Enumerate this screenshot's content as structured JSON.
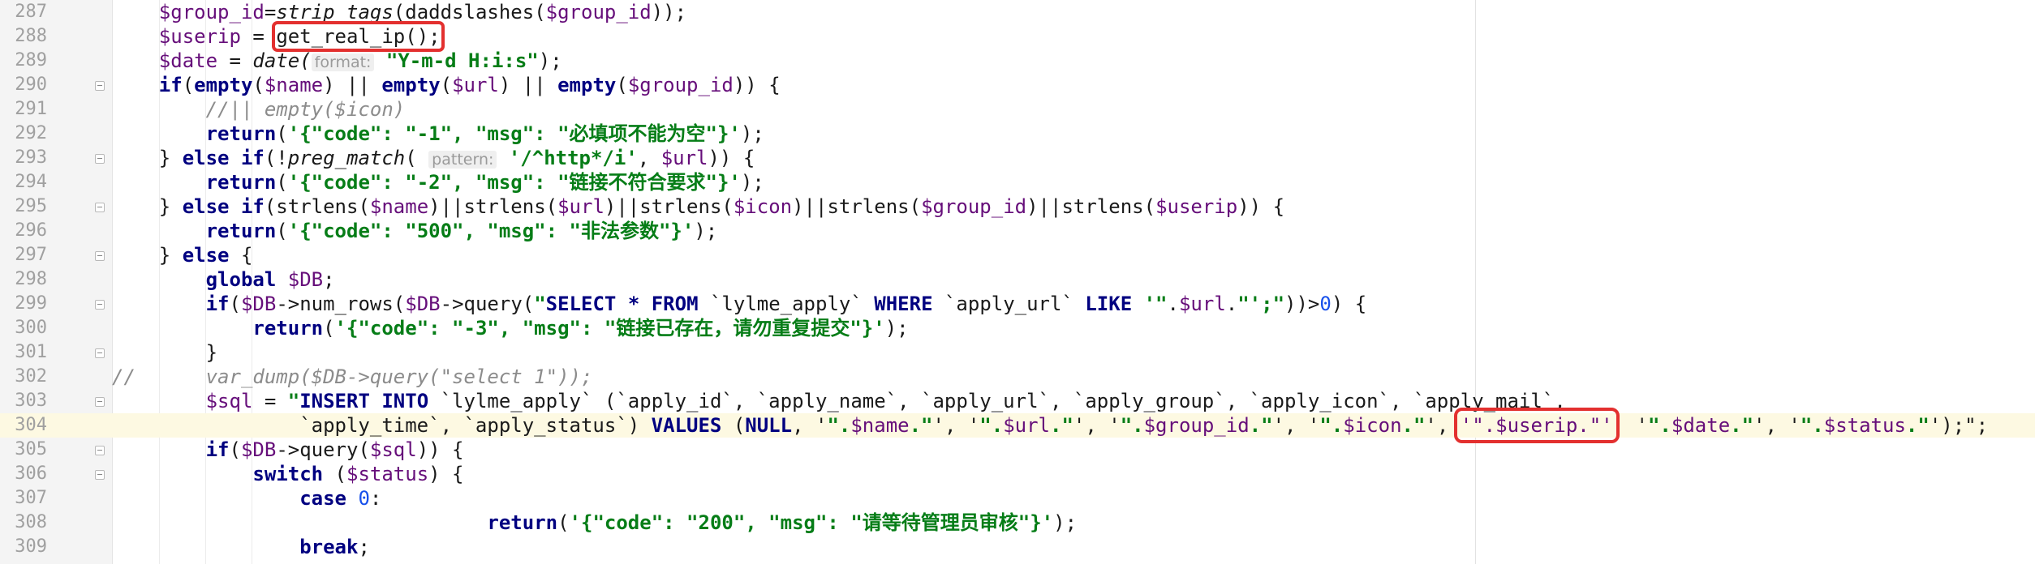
{
  "editor": {
    "lines": [
      {
        "num": "287",
        "indent": 1,
        "tokens": [
          {
            "t": "$group_id",
            "c": "var"
          },
          {
            "t": "=",
            "c": "fn"
          },
          {
            "t": "strip_tags",
            "c": "fni"
          },
          {
            "t": "(daddslashes(",
            "c": "fn"
          },
          {
            "t": "$group_id",
            "c": "var"
          },
          {
            "t": "));",
            "c": "fn"
          }
        ]
      },
      {
        "num": "288",
        "indent": 1,
        "tokens": [
          {
            "t": "$userip",
            "c": "var"
          },
          {
            "t": " = ",
            "c": "fn"
          },
          {
            "t": "get_real_ip();",
            "c": "fn",
            "box": "redbox"
          }
        ]
      },
      {
        "num": "289",
        "indent": 1,
        "tokens": [
          {
            "t": "$date",
            "c": "var"
          },
          {
            "t": " = ",
            "c": "fn"
          },
          {
            "t": "date(",
            "c": "fni"
          },
          {
            "t": "format:",
            "c": "hint"
          },
          {
            "t": " \"Y-m-d H:i:s\"",
            "c": "str"
          },
          {
            "t": ");",
            "c": "fn"
          }
        ]
      },
      {
        "num": "290",
        "indent": 1,
        "fold": true,
        "tokens": [
          {
            "t": "if",
            "c": "kw"
          },
          {
            "t": "(",
            "c": "fn"
          },
          {
            "t": "empty",
            "c": "kw"
          },
          {
            "t": "(",
            "c": "fn"
          },
          {
            "t": "$name",
            "c": "var"
          },
          {
            "t": ") || ",
            "c": "fn"
          },
          {
            "t": "empty",
            "c": "kw"
          },
          {
            "t": "(",
            "c": "fn"
          },
          {
            "t": "$url",
            "c": "var"
          },
          {
            "t": ") || ",
            "c": "fn"
          },
          {
            "t": "empty",
            "c": "kw"
          },
          {
            "t": "(",
            "c": "fn"
          },
          {
            "t": "$group_id",
            "c": "var"
          },
          {
            "t": ")) {",
            "c": "fn"
          }
        ]
      },
      {
        "num": "291",
        "indent": 2,
        "tokens": [
          {
            "t": "//|| empty($icon)",
            "c": "cmt"
          }
        ]
      },
      {
        "num": "292",
        "indent": 2,
        "tokens": [
          {
            "t": "return",
            "c": "kw"
          },
          {
            "t": "(",
            "c": "fn"
          },
          {
            "t": "'{\"code\": \"-1\", \"msg\": \"必填项不能为空\"}'",
            "c": "str"
          },
          {
            "t": ");",
            "c": "fn"
          }
        ]
      },
      {
        "num": "293",
        "indent": 1,
        "fold": true,
        "tokens": [
          {
            "t": "} ",
            "c": "fn"
          },
          {
            "t": "else if",
            "c": "kw"
          },
          {
            "t": "(!",
            "c": "fn"
          },
          {
            "t": "preg_match",
            "c": "fni"
          },
          {
            "t": "( ",
            "c": "fn"
          },
          {
            "t": "pattern:",
            "c": "hint"
          },
          {
            "t": " '/^http*/i'",
            "c": "str"
          },
          {
            "t": ", ",
            "c": "fn"
          },
          {
            "t": "$url",
            "c": "var"
          },
          {
            "t": ")) {",
            "c": "fn"
          }
        ]
      },
      {
        "num": "294",
        "indent": 2,
        "tokens": [
          {
            "t": "return",
            "c": "kw"
          },
          {
            "t": "(",
            "c": "fn"
          },
          {
            "t": "'{\"code\": \"-2\", \"msg\": \"链接不符合要求\"}'",
            "c": "str"
          },
          {
            "t": ");",
            "c": "fn"
          }
        ]
      },
      {
        "num": "295",
        "indent": 1,
        "fold": true,
        "tokens": [
          {
            "t": "} ",
            "c": "fn"
          },
          {
            "t": "else if",
            "c": "kw"
          },
          {
            "t": "(strlens(",
            "c": "fn"
          },
          {
            "t": "$name",
            "c": "var"
          },
          {
            "t": ")||strlens(",
            "c": "fn"
          },
          {
            "t": "$url",
            "c": "var"
          },
          {
            "t": ")||strlens(",
            "c": "fn"
          },
          {
            "t": "$icon",
            "c": "var"
          },
          {
            "t": ")||strlens(",
            "c": "fn"
          },
          {
            "t": "$group_id",
            "c": "var"
          },
          {
            "t": ")||strlens(",
            "c": "fn"
          },
          {
            "t": "$userip",
            "c": "var"
          },
          {
            "t": ")) {",
            "c": "fn"
          }
        ]
      },
      {
        "num": "296",
        "indent": 2,
        "tokens": [
          {
            "t": "return",
            "c": "kw"
          },
          {
            "t": "(",
            "c": "fn"
          },
          {
            "t": "'{\"code\": \"500\", \"msg\": \"非法参数\"}'",
            "c": "str"
          },
          {
            "t": ");",
            "c": "fn"
          }
        ]
      },
      {
        "num": "297",
        "indent": 1,
        "fold": true,
        "tokens": [
          {
            "t": "} ",
            "c": "fn"
          },
          {
            "t": "else",
            "c": "kw"
          },
          {
            "t": " {",
            "c": "fn"
          }
        ]
      },
      {
        "num": "298",
        "indent": 2,
        "tokens": [
          {
            "t": "global",
            "c": "kw"
          },
          {
            "t": " ",
            "c": "fn"
          },
          {
            "t": "$DB",
            "c": "var"
          },
          {
            "t": ";",
            "c": "fn"
          }
        ]
      },
      {
        "num": "299",
        "indent": 2,
        "fold": true,
        "tokens": [
          {
            "t": "if",
            "c": "kw"
          },
          {
            "t": "(",
            "c": "fn"
          },
          {
            "t": "$DB",
            "c": "var"
          },
          {
            "t": "->num_rows(",
            "c": "fn"
          },
          {
            "t": "$DB",
            "c": "var"
          },
          {
            "t": "->query(",
            "c": "fn"
          },
          {
            "t": "\"",
            "c": "str"
          },
          {
            "t": "SELECT * FROM",
            "c": "sqlkw"
          },
          {
            "t": " `lylme_apply` ",
            "c": "fn"
          },
          {
            "t": "WHERE",
            "c": "sqlkw"
          },
          {
            "t": " `apply_url` ",
            "c": "fn"
          },
          {
            "t": "LIKE",
            "c": "sqlkw"
          },
          {
            "t": " '\"",
            "c": "str"
          },
          {
            "t": ".",
            "c": "fn"
          },
          {
            "t": "$url",
            "c": "var"
          },
          {
            "t": ".",
            "c": "fn"
          },
          {
            "t": "\"';\"",
            "c": "str"
          },
          {
            "t": "))>",
            "c": "fn"
          },
          {
            "t": "0",
            "c": "num"
          },
          {
            "t": ") {",
            "c": "fn"
          }
        ]
      },
      {
        "num": "300",
        "indent": 3,
        "tokens": [
          {
            "t": "return",
            "c": "kw"
          },
          {
            "t": "(",
            "c": "fn"
          },
          {
            "t": "'{\"code\": \"-3\", \"msg\": \"链接已存在，请勿重复提交\"}'",
            "c": "str"
          },
          {
            "t": ");",
            "c": "fn"
          }
        ]
      },
      {
        "num": "301",
        "indent": 2,
        "fold": true,
        "tokens": [
          {
            "t": "}",
            "c": "fn"
          }
        ]
      },
      {
        "num": "302",
        "indent": 0,
        "tokens": [
          {
            "t": "//      var_dump($DB->query(\"select 1\"));",
            "c": "cmt"
          }
        ]
      },
      {
        "num": "303",
        "indent": 2,
        "fold": true,
        "tokens": [
          {
            "t": "$sql",
            "c": "var"
          },
          {
            "t": " = ",
            "c": "fn"
          },
          {
            "t": "\"",
            "c": "str"
          },
          {
            "t": "INSERT INTO",
            "c": "sqlkw"
          },
          {
            "t": " `lylme_apply` (`apply_id`, `apply_name`, `apply_url`, `apply_group`, `apply_icon`, `apply_mail`,",
            "c": "fn"
          }
        ]
      },
      {
        "num": "304",
        "indent": 4,
        "highlight": true,
        "tokens": [
          {
            "t": "`apply_time`, `apply_status`) ",
            "c": "fn"
          },
          {
            "t": "VALUES",
            "c": "sqlkw"
          },
          {
            "t": " (",
            "c": "fn"
          },
          {
            "t": "NULL",
            "c": "sqlkw"
          },
          {
            "t": ", '",
            "c": "fn"
          },
          {
            "t": "\".",
            "c": "str"
          },
          {
            "t": "$name",
            "c": "var"
          },
          {
            "t": ".\"",
            "c": "str"
          },
          {
            "t": "', '",
            "c": "fn"
          },
          {
            "t": "\".",
            "c": "str"
          },
          {
            "t": "$url",
            "c": "var"
          },
          {
            "t": ".\"",
            "c": "str"
          },
          {
            "t": "', '",
            "c": "fn"
          },
          {
            "t": "\".",
            "c": "str"
          },
          {
            "t": "$group_id",
            "c": "var"
          },
          {
            "t": ".\"",
            "c": "str"
          },
          {
            "t": "', '",
            "c": "fn"
          },
          {
            "t": "\".",
            "c": "str"
          },
          {
            "t": "$icon",
            "c": "var"
          },
          {
            "t": ".\"",
            "c": "str"
          },
          {
            "t": "', ",
            "c": "fn"
          },
          {
            "t": "'\".$userip.\"'",
            "c": "var",
            "box": "redbox2"
          },
          {
            "t": "  '",
            "c": "fn"
          },
          {
            "t": "\".",
            "c": "str"
          },
          {
            "t": "$date",
            "c": "var"
          },
          {
            "t": ".\"",
            "c": "str"
          },
          {
            "t": "', '",
            "c": "fn"
          },
          {
            "t": "\".",
            "c": "str"
          },
          {
            "t": "$status",
            "c": "var"
          },
          {
            "t": ".\"",
            "c": "str"
          },
          {
            "t": "');\";",
            "c": "fn"
          }
        ]
      },
      {
        "num": "305",
        "indent": 2,
        "fold": true,
        "tokens": [
          {
            "t": "if",
            "c": "kw"
          },
          {
            "t": "(",
            "c": "fn"
          },
          {
            "t": "$DB",
            "c": "var"
          },
          {
            "t": "->query(",
            "c": "fn"
          },
          {
            "t": "$sql",
            "c": "var"
          },
          {
            "t": ")) {",
            "c": "fn"
          }
        ]
      },
      {
        "num": "306",
        "indent": 3,
        "fold": true,
        "tokens": [
          {
            "t": "switch",
            "c": "kw"
          },
          {
            "t": " (",
            "c": "fn"
          },
          {
            "t": "$status",
            "c": "var"
          },
          {
            "t": ") {",
            "c": "fn"
          }
        ]
      },
      {
        "num": "307",
        "indent": 4,
        "tokens": [
          {
            "t": "case",
            "c": "kw"
          },
          {
            "t": " ",
            "c": "fn"
          },
          {
            "t": "0",
            "c": "num"
          },
          {
            "t": ":",
            "c": "fn"
          }
        ]
      },
      {
        "num": "308",
        "indent": 8,
        "tokens": [
          {
            "t": "return",
            "c": "kw"
          },
          {
            "t": "(",
            "c": "fn"
          },
          {
            "t": "'{\"code\": \"200\", \"msg\": \"请等待管理员审核\"}'",
            "c": "str"
          },
          {
            "t": ");",
            "c": "fn"
          }
        ]
      },
      {
        "num": "309",
        "indent": 4,
        "tokens": [
          {
            "t": "break",
            "c": "kw"
          },
          {
            "t": ";",
            "c": "fn"
          }
        ]
      }
    ]
  }
}
